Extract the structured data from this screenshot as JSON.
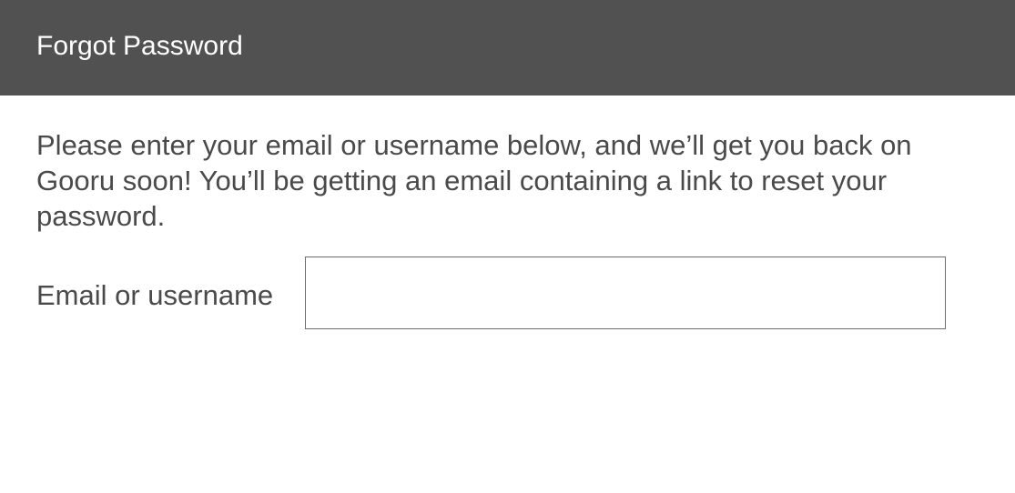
{
  "header": {
    "title": "Forgot Password"
  },
  "form": {
    "description": "Please enter your email or username below, and we’ll get you back on Gooru soon! You’ll be getting an email containing a link to reset your password.",
    "email_label": "Email or username",
    "email_value": "",
    "email_placeholder": ""
  }
}
